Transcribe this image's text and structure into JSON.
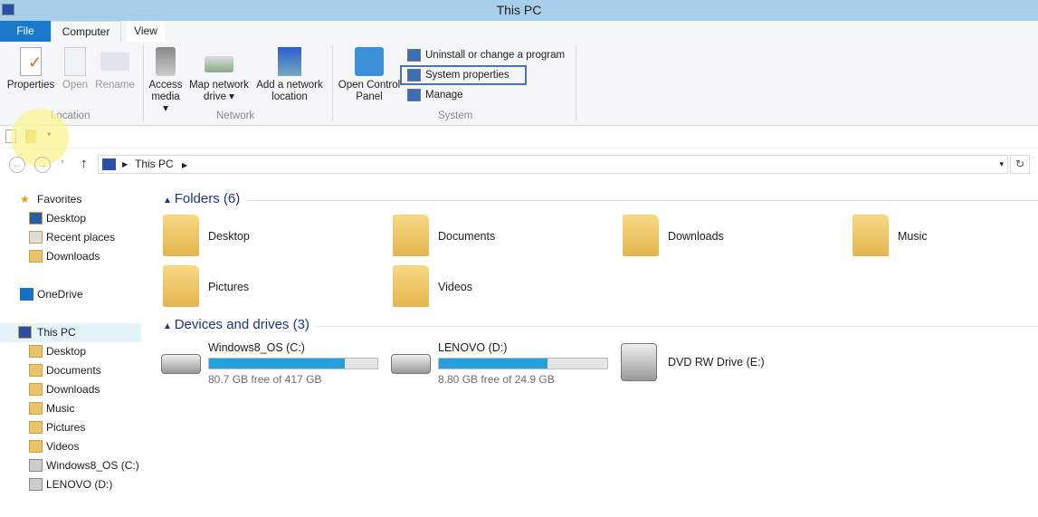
{
  "window": {
    "title": "This PC"
  },
  "tabs": {
    "file": "File",
    "computer": "Computer",
    "view": "View"
  },
  "ribbon": {
    "location": {
      "label": "Location",
      "properties": "Properties",
      "open": "Open",
      "rename": "Rename"
    },
    "network": {
      "label": "Network",
      "access_media_1": "Access",
      "access_media_2": "media ▾",
      "map_drive_1": "Map network",
      "map_drive_2": "drive ▾",
      "add_location_1": "Add a network",
      "add_location_2": "location"
    },
    "system": {
      "label": "System",
      "control_panel_1": "Open Control",
      "control_panel_2": "Panel",
      "uninstall": "Uninstall or change a program",
      "system_properties": "System properties",
      "manage": "Manage"
    }
  },
  "address": {
    "path": "This PC",
    "refresh": "↻"
  },
  "sidebar": {
    "favorites": "Favorites",
    "fav_items": [
      "Desktop",
      "Recent places",
      "Downloads"
    ],
    "onedrive": "OneDrive",
    "thispc": "This PC",
    "pc_items": [
      "Desktop",
      "Documents",
      "Downloads",
      "Music",
      "Pictures",
      "Videos",
      "Windows8_OS (C:)",
      "LENOVO (D:)"
    ]
  },
  "folders": {
    "heading": "Folders (6)",
    "items": [
      "Desktop",
      "Documents",
      "Downloads",
      "Music",
      "Pictures",
      "Videos"
    ]
  },
  "drives": {
    "heading": "Devices and drives (3)",
    "items": [
      {
        "name": "Windows8_OS (C:)",
        "free": "80.7 GB free of 417 GB",
        "used_pct": 80.6
      },
      {
        "name": "LENOVO (D:)",
        "free": "8.80 GB free of 24.9 GB",
        "used_pct": 64.7
      },
      {
        "name": "DVD RW Drive (E:)"
      }
    ]
  }
}
